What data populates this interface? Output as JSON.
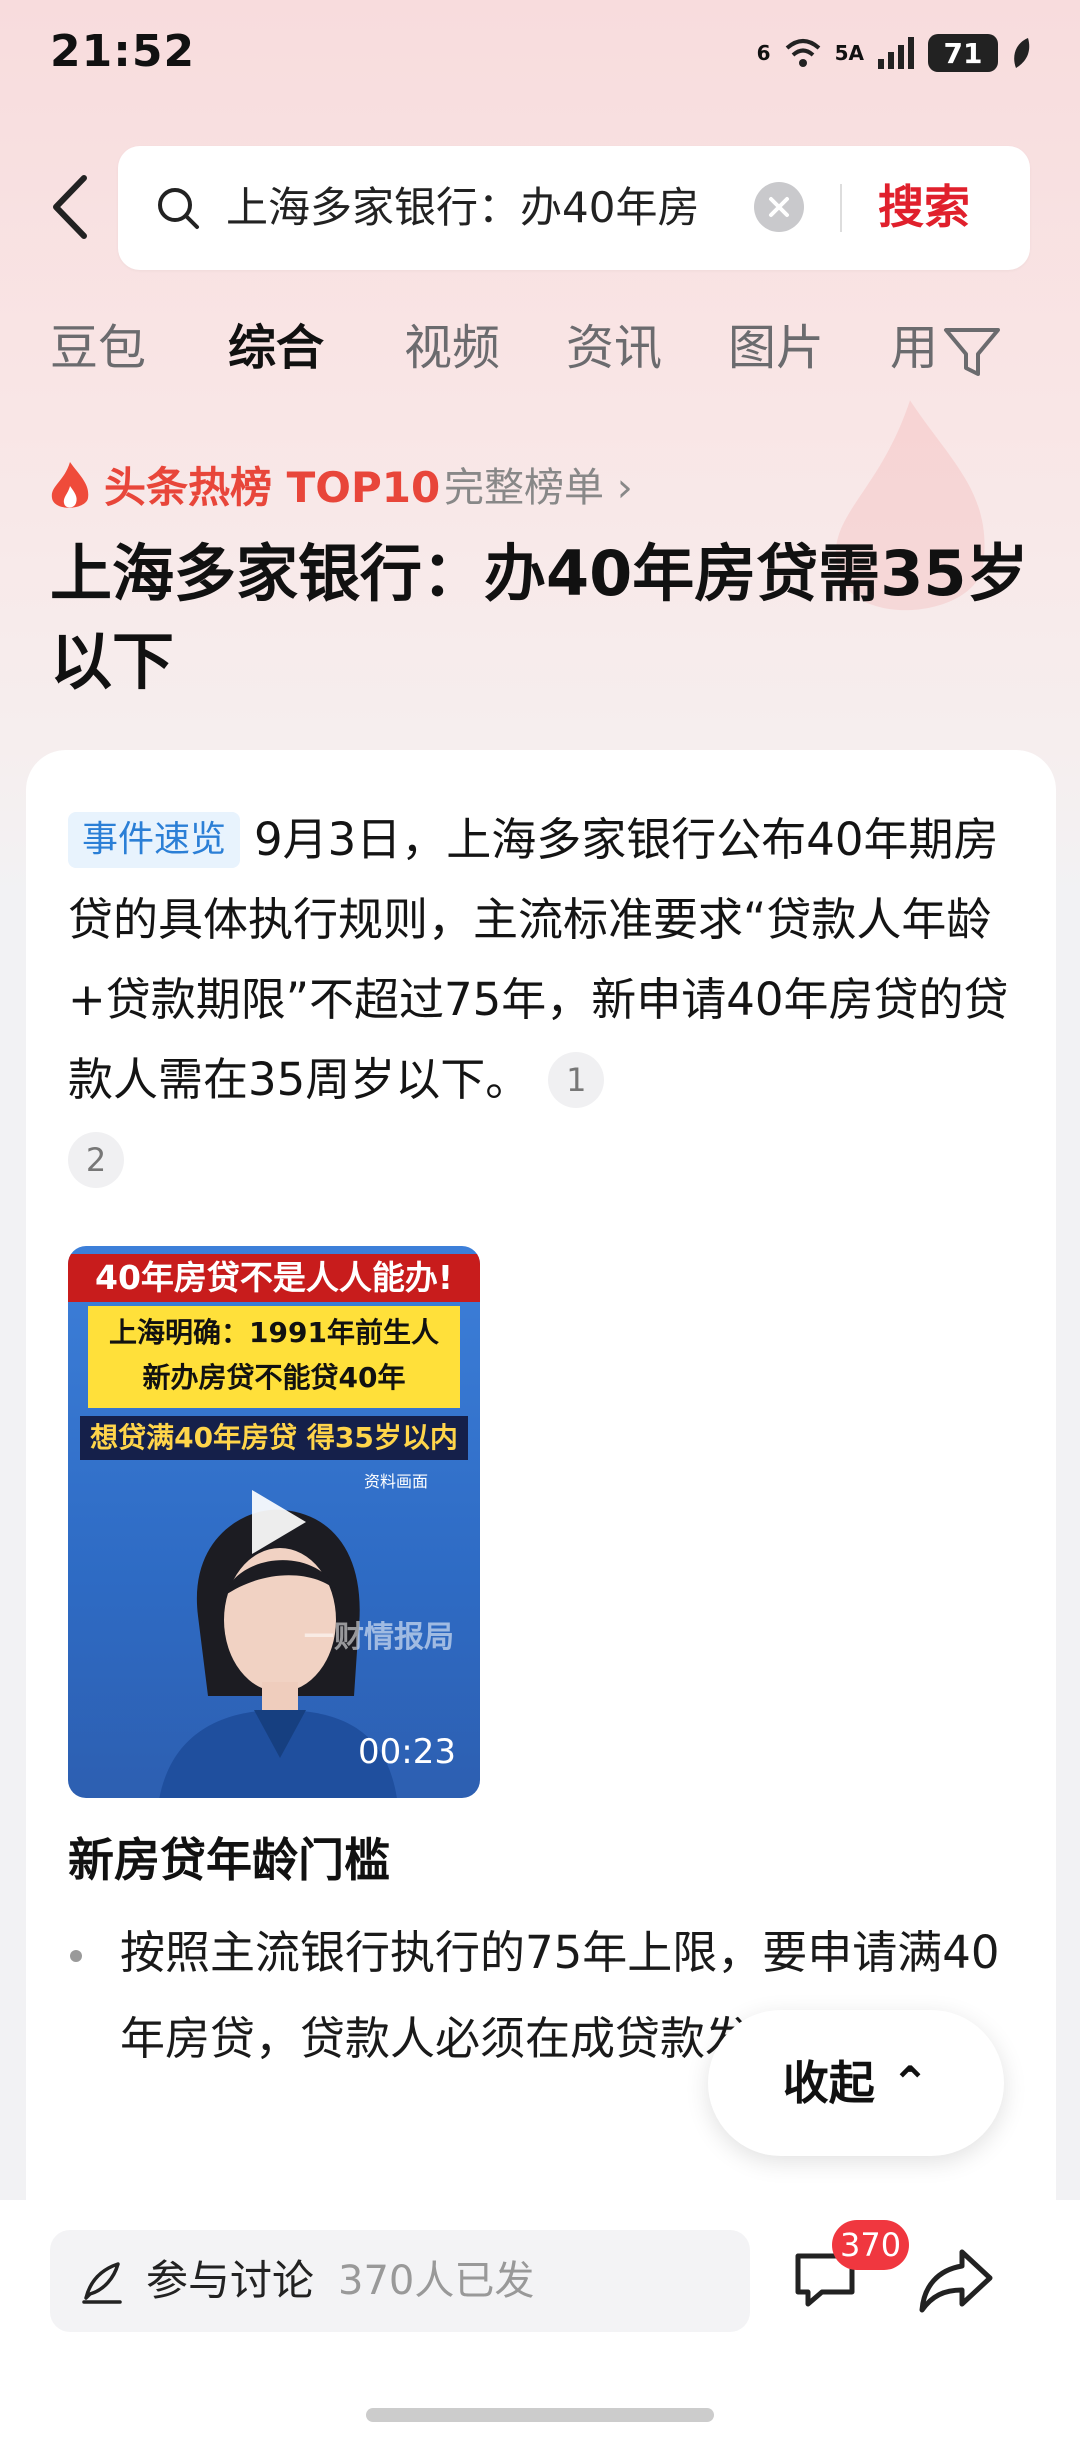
{
  "status_bar": {
    "time": "21:52",
    "network_1": "6",
    "network_2": "5A",
    "battery": "71"
  },
  "search": {
    "query": "上海多家银行：办40年房",
    "submit_label": "搜索"
  },
  "tabs": [
    {
      "label": "豆包"
    },
    {
      "label": "综合",
      "active": true
    },
    {
      "label": "视频"
    },
    {
      "label": "资讯"
    },
    {
      "label": "图片"
    },
    {
      "label": "用"
    }
  ],
  "hot_rank": {
    "label": "头条热榜 TOP10",
    "full_list_link": "完整榜单 ›"
  },
  "headline": "上海多家银行：办40年房贷需35岁以下",
  "summary": {
    "tag": "事件速览",
    "text": "9月3日，上海多家银行公布40年期房贷的具体执行规则，主流标准要求“贷款人年龄+贷款期限”不超过75年，新申请40年房贷的贷款人需在35周岁以下。",
    "citations": [
      "1",
      "2"
    ]
  },
  "video": {
    "banner1": "40年房贷不是人人能办!",
    "banner2_line1": "上海明确：1991年前生人",
    "banner2_line2": "新办房贷不能贷40年",
    "banner3": "想贷满40年房贷 得35岁以内",
    "caption": "资料画面",
    "watermark": "一财情报局",
    "duration": "00:23"
  },
  "section": {
    "title": "新房贷年龄门槛",
    "bullet": "按照主流银行执行的75年上限，要申请满40年房贷，贷款人必须在成贷款发放。"
  },
  "collapse_label": "收起 ⌃",
  "bottom_bar": {
    "discuss_label": "参与讨论",
    "discuss_count": "370人已发",
    "comment_badge": "370"
  },
  "colors": {
    "accent_red": "#e0202c",
    "hot_orange": "#e8463a",
    "tag_blue": "#2b7fd6"
  }
}
